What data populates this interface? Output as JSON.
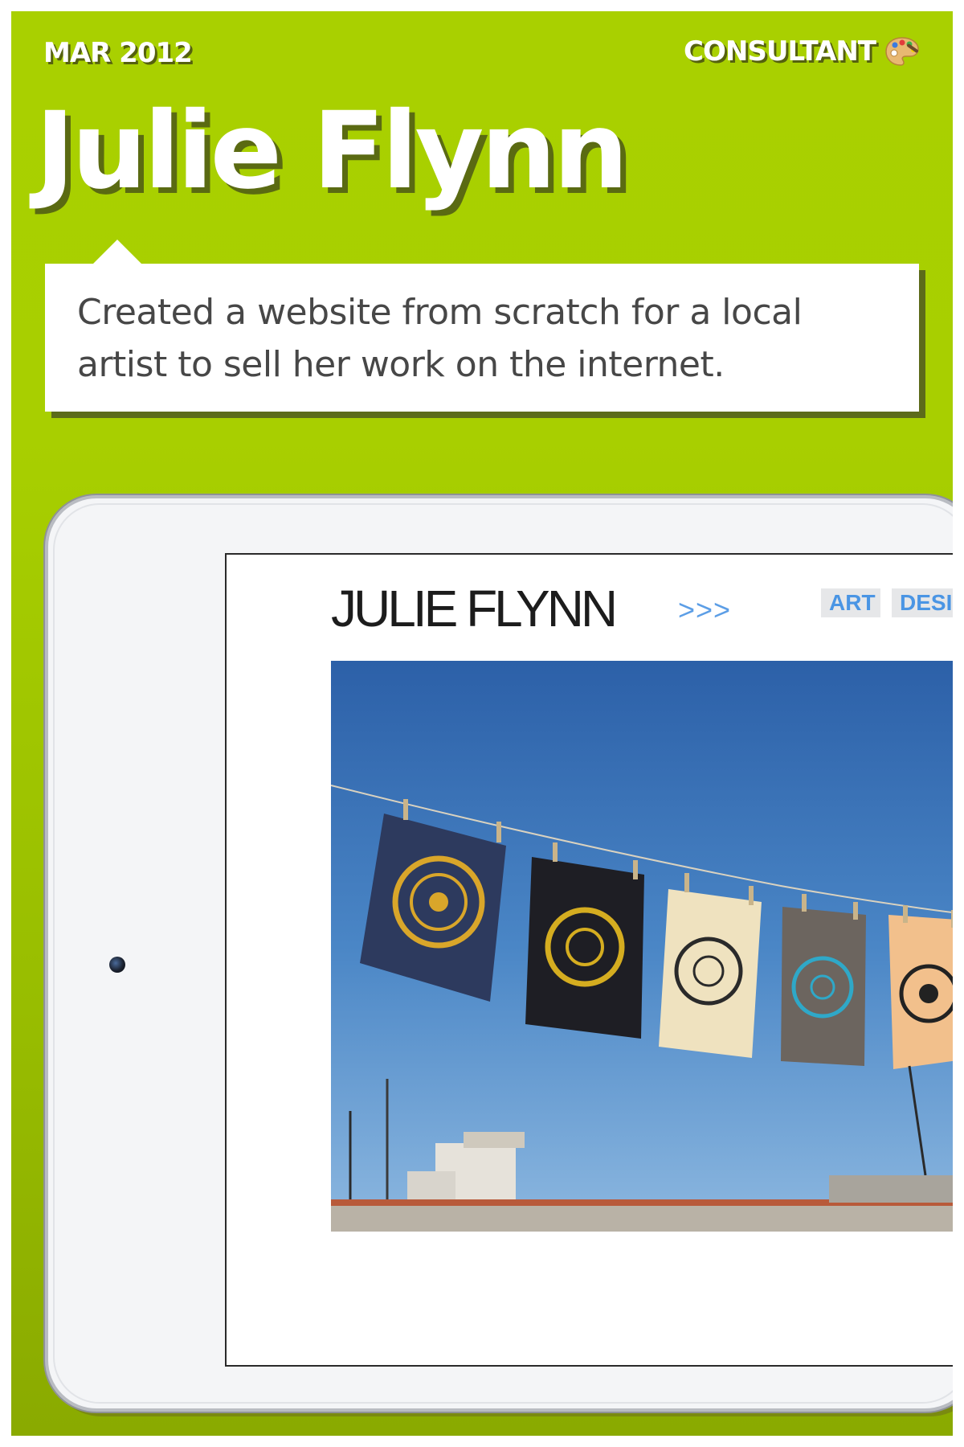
{
  "header": {
    "date": "MAR 2012",
    "role": "CONSULTANT",
    "role_icon": "artist-palette-icon"
  },
  "project": {
    "client_name": "Julie Flynn",
    "description": "Created a website from scratch for a local artist to sell her work on the internet."
  },
  "device": {
    "type": "tablet",
    "website": {
      "title": "JULIE FLYNN",
      "arrows": ">>>",
      "nav": [
        {
          "label": "ART"
        },
        {
          "label": "DESIGN"
        }
      ],
      "hero_image": "prints-on-clothesline-photo"
    }
  },
  "colors": {
    "card_green": "#a9d000",
    "shadow_olive": "#5a6a12",
    "desc_text": "#474747",
    "nav_blue": "#4a95e4",
    "arrows_blue": "#5c9ee6"
  }
}
